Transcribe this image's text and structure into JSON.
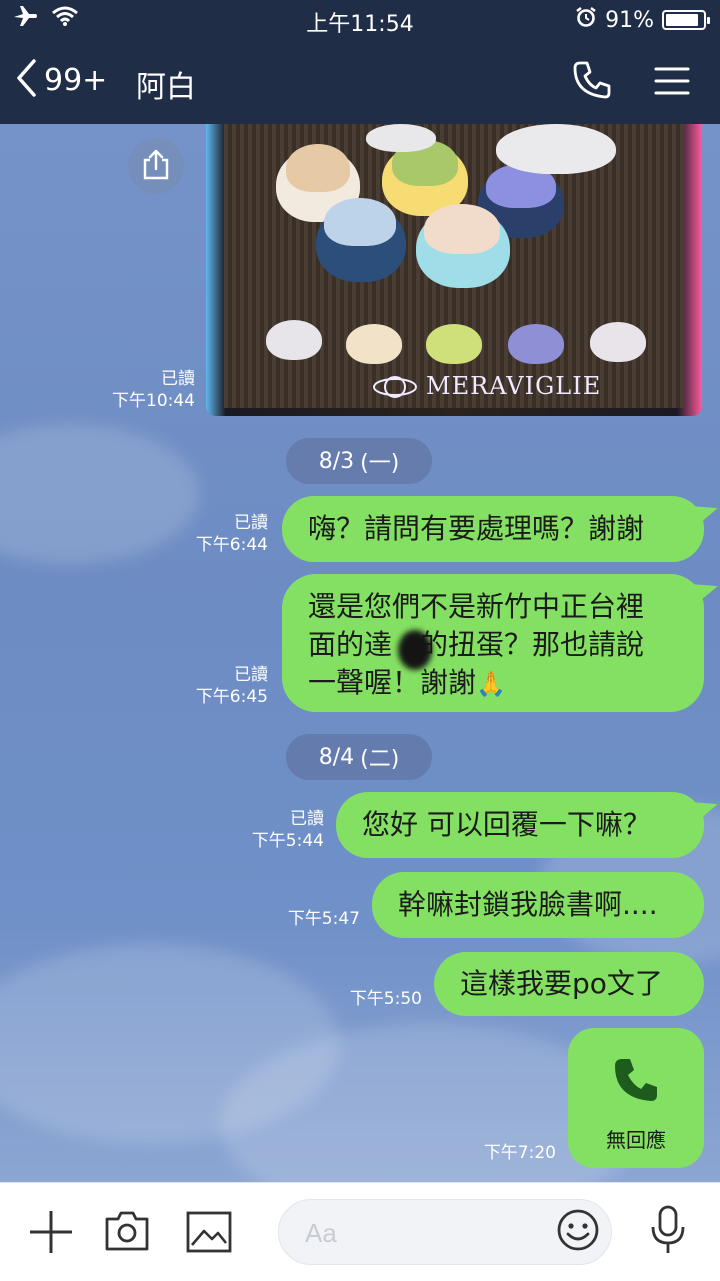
{
  "status_bar": {
    "time": "上午11:54",
    "battery_percent": "91%",
    "battery_level": 0.91,
    "icons": [
      "airplane-icon",
      "wifi-icon",
      "alarm-icon",
      "battery-icon"
    ]
  },
  "header": {
    "unread_count": "99+",
    "contact_name": "阿白",
    "icons": [
      "back-chevron-icon",
      "phone-icon",
      "menu-icon"
    ]
  },
  "image_message": {
    "brand": "MERAVIGLIE",
    "read_status": "已讀",
    "time": "下午10:44"
  },
  "date_separators": {
    "d1": {
      "date": "8/3",
      "weekday": "(一)"
    },
    "d2": {
      "date": "8/4",
      "weekday": "(二)"
    }
  },
  "messages": [
    {
      "text": "嗨？請問有要處理嗎？謝謝",
      "read": "已讀",
      "time": "下午6:44"
    },
    {
      "line1": "還是您們不是新竹中正台裡",
      "line2a": "面的達",
      "line2b": "的扭蛋？那也請說",
      "line3": "一聲喔！謝謝",
      "emoji": "🙏",
      "read": "已讀",
      "time": "下午6:45"
    },
    {
      "text": "您好 可以回覆一下嘛？",
      "read": "已讀",
      "time": "下午5:44"
    },
    {
      "text": "幹嘛封鎖我臉書啊....",
      "time": "下午5:47"
    },
    {
      "text": "這樣我要po文了",
      "time": "下午5:50"
    }
  ],
  "call_message": {
    "label": "無回應",
    "time": "下午7:20"
  },
  "input_bar": {
    "placeholder": "Aa",
    "icons": [
      "plus-icon",
      "camera-icon",
      "image-icon",
      "emoji-icon",
      "microphone-icon"
    ]
  },
  "colors": {
    "header_bg": "#1f2d47",
    "bubble_green": "#84e062",
    "chat_bg": "#6f8fc4"
  }
}
